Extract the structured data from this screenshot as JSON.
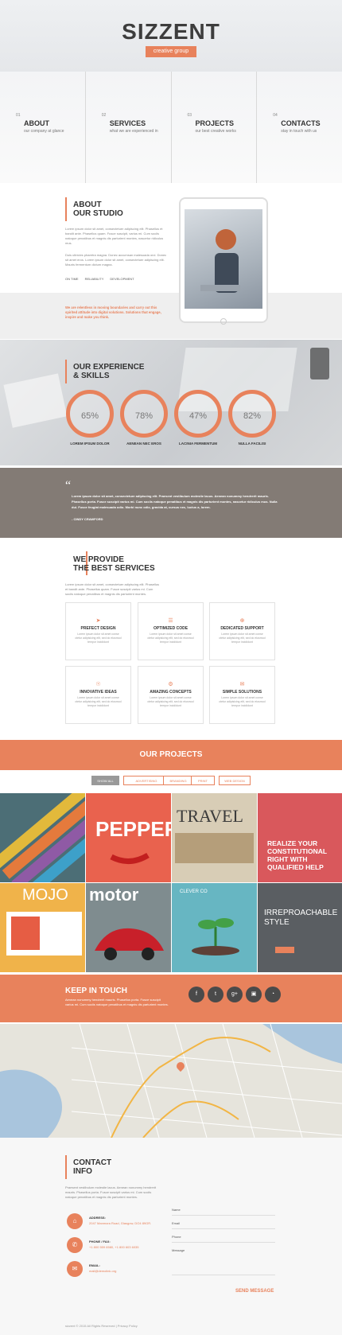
{
  "brand": {
    "title": "SIZZENT",
    "subtitle": "creative group"
  },
  "nav": [
    {
      "num": "01",
      "title": "ABOUT",
      "sub": "our company at glance"
    },
    {
      "num": "02",
      "title": "SERVICES",
      "sub": "what we are experienced in"
    },
    {
      "num": "03",
      "title": "PROJECTS",
      "sub": "our best creative works"
    },
    {
      "num": "04",
      "title": "CONTACTS",
      "sub": "stay in touch with us"
    }
  ],
  "about": {
    "title1": "ABOUT",
    "title2": "OUR STUDIO",
    "p1": "Lorem ipsum dolor sit amet, consectetuer adipiscing elit. Phasellus et bandit ante. Phasellus quam. Fusce suscipit, varius mi. Cum sociis natoque penatibus et magnis dis parturient montes, nascetur ridiculus mus.",
    "p2": "Duis ultricies pharetra magna. Donec accumsan malesuada orci. Donec sit amet eros. Lorem ipsum dolor sit amet, consectetuer adipiscing elit. Mauris fermentum dictum magna.",
    "tags": [
      "ON TIME",
      "RELIABILITY",
      "DEVELOPMENT"
    ],
    "highlight": "We are relentless in moving boundaries and carry out this spirited attitude into digital solutions. Solutions that engage, inspire and make you think."
  },
  "skills": {
    "title1": "OUR EXPERIENCE",
    "title2": "& SKILLS",
    "items": [
      {
        "value": "65%",
        "label": "LOREM IPSUM DOLOR"
      },
      {
        "value": "78%",
        "label": "AENEAN NEC EROS"
      },
      {
        "value": "47%",
        "label": "LACINIA FERMENTUM"
      },
      {
        "value": "82%",
        "label": "NULLA FACILISI"
      }
    ]
  },
  "quote": {
    "mark": "“",
    "text": "Lorem ipsum dolor sit amet, consectetuer adipiscing elit. Praesent vestibulum molestie lacus. Aenean nonummy hendrerit mauris. Phasellus porta. Fusce suscipit varius mi. Cum sociis natoque penatibus et magnis dis parturient montes, nascetur ridiculus mus. Nulla dui. Fusce feugiat malesuada odio. Morbi nunc odio, gravida at, cursus nec, luctus a, lorem.",
    "author": "- CINDY CRAWFORD"
  },
  "services": {
    "title1": "WE PROVIDE",
    "title2": "THE BEST SERVICES",
    "intro": "Lorem ipsum dolor sit amet, consectetuer adipiscing elit. Phasellus et bandit ante. Phasellus quam. Fusce suscipit varius mi. Cum sociis natoque penatibus et magnis dis parturient montes.",
    "items": [
      {
        "icon": "paper-plane-icon",
        "glyph": "➤",
        "title": "PREFECT DESIGN",
        "desc": "Lorem ipsum dolor sit amet conse ctetur adipisicing elit, sed do eiusmod tempor incididunt"
      },
      {
        "icon": "code-icon",
        "glyph": "☰",
        "title": "OPTIMIZED CODE",
        "desc": "Lorem ipsum dolor sit amet conse ctetur adipisicing elit, sed do eiusmod tempor incididunt"
      },
      {
        "icon": "lifebuoy-icon",
        "glyph": "⊕",
        "title": "DEDICATED SUPPORT",
        "desc": "Lorem ipsum dolor sit amet conse ctetur adipisicing elit, sed do eiusmod tempor incididunt"
      },
      {
        "icon": "lightbulb-icon",
        "glyph": "☉",
        "title": "INNOVATIVE IDEAS",
        "desc": "Lorem ipsum dolor sit amet conse ctetur adipisicing elit, sed do eiusmod tempor incididunt"
      },
      {
        "icon": "gears-icon",
        "glyph": "⚙",
        "title": "AMAZING CONCEPTS",
        "desc": "Lorem ipsum dolor sit amet conse ctetur adipisicing elit, sed do eiusmod tempor incididunt"
      },
      {
        "icon": "chat-icon",
        "glyph": "✉",
        "title": "SIMPLE SOLUTIONS",
        "desc": "Lorem ipsum dolor sit amet conse ctetur adipisicing elit, sed do eiusmod tempor incididunt"
      }
    ]
  },
  "projects": {
    "title": "OUR PROJECTS",
    "tabs": [
      "SHOW ALL",
      "ADVERTISING",
      "BRANDING",
      "PRINT",
      "WEB DESIGN"
    ],
    "tiles": [
      {
        "name": "stripes",
        "color": "#4c6e76"
      },
      {
        "name": "pepper",
        "color": "#e9624e",
        "text": "PEPPER"
      },
      {
        "name": "travel",
        "color": "#d8cdb6",
        "text": "TRAVEL"
      },
      {
        "name": "realize",
        "color": "#d9585c",
        "text": "REALIZE YOUR CONSTITUTIONAL RIGHT WITH QUALIFIED HELP"
      },
      {
        "name": "mojo",
        "color": "#f0b34a",
        "text": "MOJO"
      },
      {
        "name": "motor",
        "color": "#7f8c8f",
        "text": "motor"
      },
      {
        "name": "clever",
        "color": "#67b6c2",
        "text": "CLEVER CO"
      },
      {
        "name": "style",
        "color": "#5a5e62",
        "text": "IRREPROACHABLE STYLE"
      }
    ]
  },
  "touch": {
    "title": "KEEP IN TOUCH",
    "text": "Aenean nonummy hendrerit mauris. Phasellus porta. Fusce suscipit varius mi. Cum sociis natoque penatibus et magnis dis parturient montes.",
    "social": [
      {
        "icon": "facebook-icon",
        "glyph": "f"
      },
      {
        "icon": "twitter-icon",
        "glyph": "t"
      },
      {
        "icon": "google-plus-icon",
        "glyph": "g+"
      },
      {
        "icon": "instagram-icon",
        "glyph": "▣"
      },
      {
        "icon": "rss-icon",
        "glyph": "◔"
      }
    ]
  },
  "contact": {
    "title1": "CONTACT",
    "title2": "INFO",
    "intro": "Praesent vestibulum molestie lacus. Aenean nonummy hendrerit mauris. Phasellus porta. Fusce suscipit varius mi. Cum sociis natoque penatibus et magnis dis parturient montes.",
    "address_label": "ADDRESS:",
    "address": "2047 Manmora Road, Glasgow, DO4 89GR.",
    "phone_label": "PHONE / FAX:",
    "phone": "+1 800 559 6580, +1 800 603 6035",
    "email_label": "EMAIL:",
    "email": "mail@demolink.org",
    "form": {
      "name": "Name",
      "email": "Email",
      "phone": "Phone",
      "message": "Message"
    },
    "send": "SEND MESSAGE"
  },
  "footer": "sizzent © 2015 All Rights Reserved | Privacy Policy",
  "colors": {
    "accent": "#e8825c",
    "dark": "#4a4a4a",
    "quote_bg": "#837b75"
  }
}
